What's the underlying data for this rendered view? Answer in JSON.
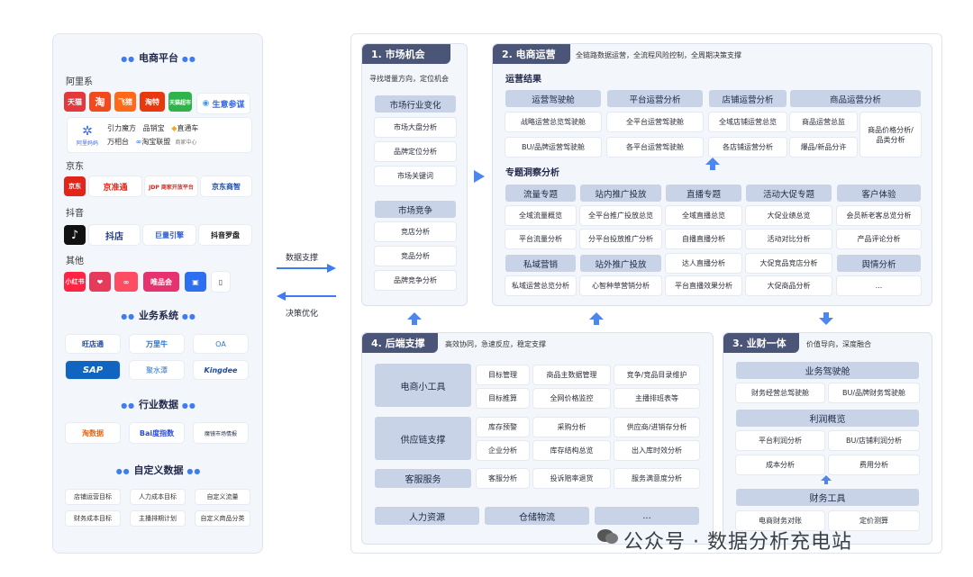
{
  "left": {
    "platform_title": "电商平台",
    "ali_label": "阿里系",
    "ali_logos": [
      "天猫",
      "淘",
      "飞猪",
      "淘特",
      "天猫超市",
      "生意参谋"
    ],
    "ali_card": {
      "row1": [
        "引力魔方",
        "品销宝",
        "直通车"
      ],
      "row2": [
        "万相台",
        "淘宝联盟",
        "商家中心"
      ],
      "icon_text": "阿里妈妈"
    },
    "jd_label": "京东",
    "jd_logos": [
      "京东",
      "京准通",
      "JDP 商家开放平台",
      "京东商智"
    ],
    "dy_label": "抖音",
    "dy_logos": [
      "抖店",
      "巨量引擎",
      "抖音罗盘"
    ],
    "other_label": "其他",
    "other_logos": [
      "小红书",
      "唯品会"
    ],
    "biz_title": "业务系统",
    "biz_logos": [
      "旺店通",
      "万里牛",
      "OA",
      "SAP",
      "聚水潭",
      "Kingdee"
    ],
    "industry_title": "行业数据",
    "industry_logos": [
      "淘数据",
      "Bai度指数",
      "魔镜市场情报"
    ],
    "custom_title": "自定义数据",
    "custom_items": [
      "店铺运营目标",
      "人力成本目标",
      "自定义流量",
      "财务成本目标",
      "主播排期计划",
      "自定义商品分类"
    ]
  },
  "arrows": {
    "support": "数据支撑",
    "optimize": "决策优化"
  },
  "p1": {
    "title": "1. 市场机会",
    "sub": "寻找增量方向，定位机会",
    "group1": [
      "市场行业变化",
      "市场大盘分析",
      "品牌定位分析",
      "市场关键词"
    ],
    "group2": [
      "市场竞争",
      "竞店分析",
      "竞品分析",
      "品牌竞争分析"
    ]
  },
  "p2": {
    "title": "2. 电商运营",
    "sub": "全链路数据运营，全流程风险控制，全周期决策支撑",
    "ops_label": "运营结果",
    "ops_headers": [
      "运营驾驶舱",
      "平台运营分析",
      "店铺运营分析",
      "商品运营分析"
    ],
    "ops_r1": [
      "战略运营总览驾驶舱",
      "全平台运营驾驶舱",
      "全域店铺运营总览",
      "商品运营总监",
      "商品价格分析/品类分析"
    ],
    "ops_r2": [
      "BU/品牌运营驾驶舱",
      "各平台运营驾驶舱",
      "各店铺运营分析",
      "爆品/新品分许"
    ],
    "topic_label": "专题洞察分析",
    "topic_headers1": [
      "流量专题",
      "站内推广投放",
      "直播专题",
      "活动大促专题",
      "客户体验"
    ],
    "topic_r1": [
      "全域流量概览",
      "全平台推广投放总览",
      "全域直播总览",
      "大促业绩总览",
      "会员新老客总览分析"
    ],
    "topic_r2": [
      "平台流量分析",
      "分平台投放推广分析",
      "自播直播分析",
      "活动对比分析",
      "产品评论分析"
    ],
    "topic_headers2": [
      "私域营销",
      "站外推广投放",
      "达人直播分析",
      "大促竞品竞店分析",
      "舆情分析"
    ],
    "topic_r3": [
      "私域运营总览分析",
      "心智种草营销分析",
      "平台直播效果分析",
      "大促商品分析",
      "..."
    ]
  },
  "p4": {
    "title": "4. 后端支撑",
    "sub": "高效协同，急速反应，稳定支撑",
    "rows": [
      {
        "label": "电商小工具",
        "items": [
          "目标管理",
          "商品主数据管理",
          "竞争/竞品目录维护",
          "目标推算",
          "全网价格监控",
          "主播排班表等"
        ]
      },
      {
        "label": "供应链支撑",
        "items": [
          "库存预警",
          "采购分析",
          "供应商/进销存分析",
          "企业分析",
          "库存结构总览",
          "出入库时效分析"
        ]
      },
      {
        "label": "客服服务",
        "items": [
          "客服分析",
          "投诉赔率退货",
          "服务满意度分析"
        ]
      }
    ],
    "bottom": [
      "人力资源",
      "仓储物流",
      "..."
    ]
  },
  "p3": {
    "title": "3. 业财一体",
    "sub": "价值导向，深度融合",
    "h1": "业务驾驶舱",
    "r1": [
      "财务经营总驾驶舱",
      "BU/品牌财务驾驶舱"
    ],
    "h2": "利润概览",
    "r2": [
      "平台利润分析",
      "BU/店铺利润分析"
    ],
    "r3": [
      "成本分析",
      "费用分析"
    ],
    "h3": "财务工具",
    "r4": [
      "电商财务对账",
      "定价测算"
    ]
  },
  "watermark": "公众号 · 数据分析充电站"
}
